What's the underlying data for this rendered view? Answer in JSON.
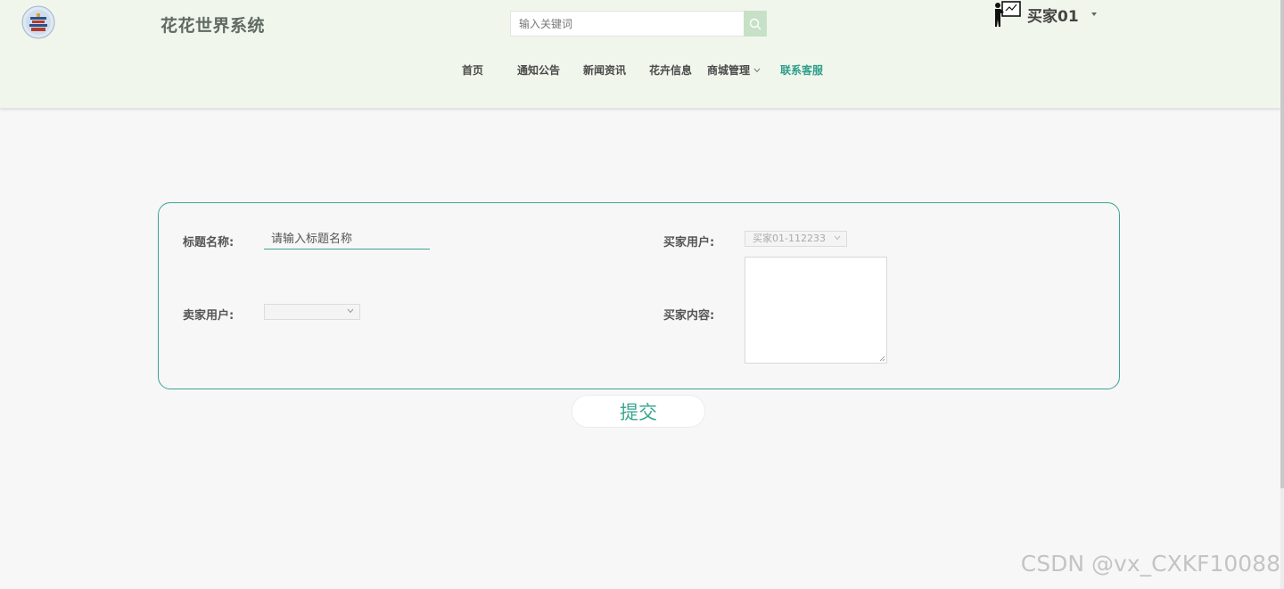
{
  "header": {
    "site_title": "花花世界系统",
    "logo_icon": "temple-logo-icon",
    "search": {
      "placeholder": "输入关键词",
      "button_icon": "search-icon"
    },
    "user": {
      "avatar_icon": "teacher-board-icon",
      "name": "买家01"
    }
  },
  "nav": {
    "items": [
      {
        "label": "首页"
      },
      {
        "label": "通知公告"
      },
      {
        "label": "新闻资讯"
      },
      {
        "label": "花卉信息"
      },
      {
        "label": "商城管理",
        "has_dropdown": true
      },
      {
        "label": "联系客服",
        "active": true
      }
    ]
  },
  "form": {
    "title_label": "标题名称:",
    "title_placeholder": "请输入标题名称",
    "seller_label": "卖家用户:",
    "seller_value": "",
    "buyer_label": "买家用户:",
    "buyer_value": "买家01-112233",
    "content_label": "买家内容:",
    "submit_label": "提交"
  },
  "watermark": "CSDN @vx_CXKF10088",
  "colors": {
    "accent": "#3aa68f",
    "header_bg": "#f1f6ec",
    "search_button": "#c7e1c6"
  }
}
